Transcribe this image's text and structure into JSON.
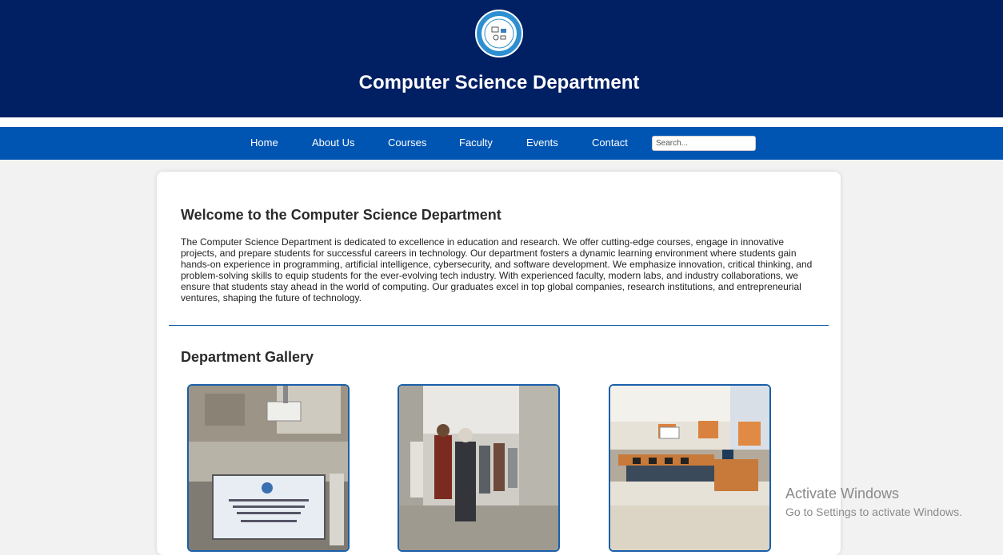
{
  "header": {
    "logo": "department-logo",
    "title": "Computer Science Department"
  },
  "nav": {
    "items": [
      {
        "label": "Home"
      },
      {
        "label": "About Us"
      },
      {
        "label": "Courses"
      },
      {
        "label": "Faculty"
      },
      {
        "label": "Events"
      },
      {
        "label": "Contact"
      }
    ],
    "search_placeholder": "Search..."
  },
  "welcome": {
    "title": "Welcome to the Computer Science Department",
    "body": "The Computer Science Department is dedicated to excellence in education and research. We offer cutting-edge courses, engage in innovative projects, and prepare students for successful careers in technology. Our department fosters a dynamic learning environment where students gain hands-on experience in programming, artificial intelligence, cybersecurity, and software development. We emphasize innovation, critical thinking, and problem-solving skills to equip students for the ever-evolving tech industry. With experienced faculty, modern labs, and industry collaborations, we ensure that students stay ahead in the world of computing. Our graduates excel in top global companies, research institutions, and entrepreneurial ventures, shaping the future of technology."
  },
  "gallery": {
    "title": "Department Gallery",
    "images": [
      "projector-classroom-photo",
      "faculty-walk-photo",
      "computer-lab-photo"
    ]
  },
  "watermark": {
    "title": "Activate Windows",
    "subtitle": "Go to Settings to activate Windows."
  },
  "colors": {
    "header_bg": "#012063",
    "nav_bg": "#0055b3",
    "accent": "#1a5faa"
  }
}
